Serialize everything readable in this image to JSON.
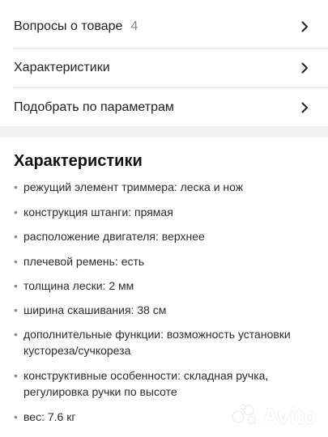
{
  "nav": [
    {
      "label": "Вопросы о товаре",
      "count": "4"
    },
    {
      "label": "Характеристики",
      "count": ""
    },
    {
      "label": "Подобрать по параметрам",
      "count": ""
    }
  ],
  "specs": {
    "title": "Характеристики",
    "items": [
      "режущий элемент триммера: леска и нож",
      "конструкция штанги: прямая",
      "расположение двигателя: верхнее",
      "плечевой ремень: есть",
      "толщина лески: 2 мм",
      "ширина скашивания: 38 см",
      "дополнительные функции: возможность установки кустореза/сучкореза",
      "конструктивные особенности: складная ручка, регулировка ручки по высоте",
      "вес: 7.6 кг"
    ],
    "bullet": "•"
  },
  "watermark": {
    "text": "Avito",
    "icon": "avito-logo-icon"
  },
  "colors": {
    "text": "#222222",
    "muted": "#8a8a8a",
    "divider": "#e6e6e6",
    "section_gap": "#f2f2f2"
  }
}
